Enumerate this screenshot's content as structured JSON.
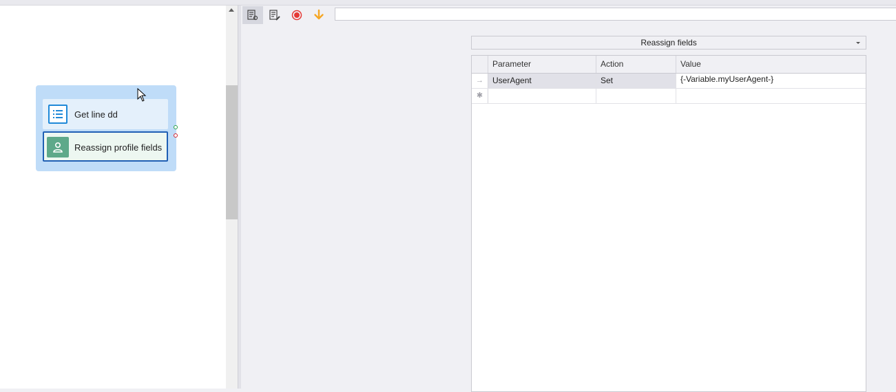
{
  "canvas": {
    "nodes": [
      {
        "label": "Get line dd",
        "icon": "list-icon"
      },
      {
        "label": "Reassign profile fields",
        "icon": "user-icon"
      }
    ]
  },
  "toolbar": {
    "buttons": [
      {
        "icon": "properties-settings-icon"
      },
      {
        "icon": "edit-notes-icon"
      },
      {
        "icon": "record-icon",
        "color": "#e53935"
      },
      {
        "icon": "arrow-down-icon",
        "color": "#f5a623"
      }
    ],
    "search_value": ""
  },
  "action": {
    "selected": "Reassign fields"
  },
  "grid": {
    "columns": [
      "Parameter",
      "Action",
      "Value"
    ],
    "rows": [
      {
        "parameter": "UserAgent",
        "action": "Set",
        "value": "{-Variable.myUserAgent-}"
      }
    ]
  }
}
